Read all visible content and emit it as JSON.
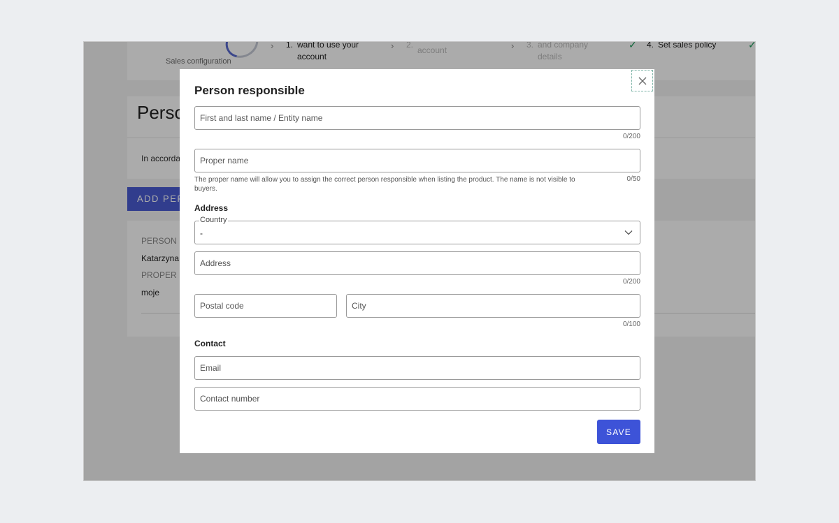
{
  "background": {
    "steps": [
      {
        "caption": "Sales configuration"
      },
      {
        "number": "1.",
        "text": "want to use your account"
      },
      {
        "number": "2.",
        "text": "account"
      },
      {
        "number": "3.",
        "text": "and company details"
      },
      {
        "number": "4.",
        "text": "Set sales policy"
      }
    ],
    "page_title": "Perso",
    "info_text": "In accorda",
    "add_button": "ADD PERS",
    "list": {
      "label_person": "PERSON R",
      "value_person": "Katarzyna",
      "label_proper": "PROPER N",
      "value_proper": "moje"
    }
  },
  "modal": {
    "title": "Person responsible",
    "close_label": "×",
    "fields": {
      "name": {
        "placeholder": "First and last name / Entity name",
        "counter": "0/200"
      },
      "proper_name": {
        "placeholder": "Proper name",
        "counter": "0/50",
        "helper": "The proper name will allow you to assign the correct person responsible when listing the product. The name is not visible to buyers."
      },
      "country": {
        "legend": "Country",
        "value": "-"
      },
      "address": {
        "placeholder": "Address",
        "counter": "0/200"
      },
      "postal_code": {
        "placeholder": "Postal code"
      },
      "city": {
        "placeholder": "City",
        "counter": "0/100"
      },
      "email": {
        "placeholder": "Email"
      },
      "contact_number": {
        "placeholder": "Contact number"
      }
    },
    "sections": {
      "address": "Address",
      "contact": "Contact"
    },
    "save_label": "SAVE"
  },
  "colors": {
    "accent": "#3d53d8",
    "success": "#1a9a5a",
    "overlay": "rgba(0,0,0,0.33)"
  }
}
